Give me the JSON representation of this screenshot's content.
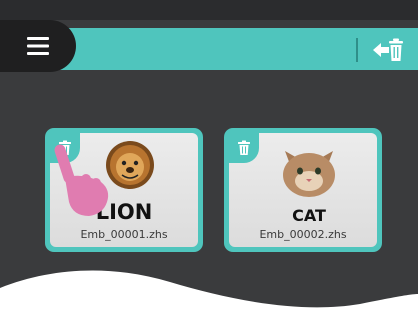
{
  "header": {
    "menu_icon": "hamburger-menu-icon",
    "exit_icon": "exit-arrow-trash-icon"
  },
  "files": [
    {
      "design_label": "LION",
      "filename": "Emb_00001.zhs",
      "delete_icon": "trash-icon"
    },
    {
      "design_label": "CAT",
      "filename": "Emb_00002.zhs",
      "delete_icon": "trash-icon"
    }
  ],
  "colors": {
    "accent": "#4fc5bd",
    "background": "#3a3b3d",
    "menu_button": "#1f1f20",
    "hand": "#e07cb0"
  }
}
